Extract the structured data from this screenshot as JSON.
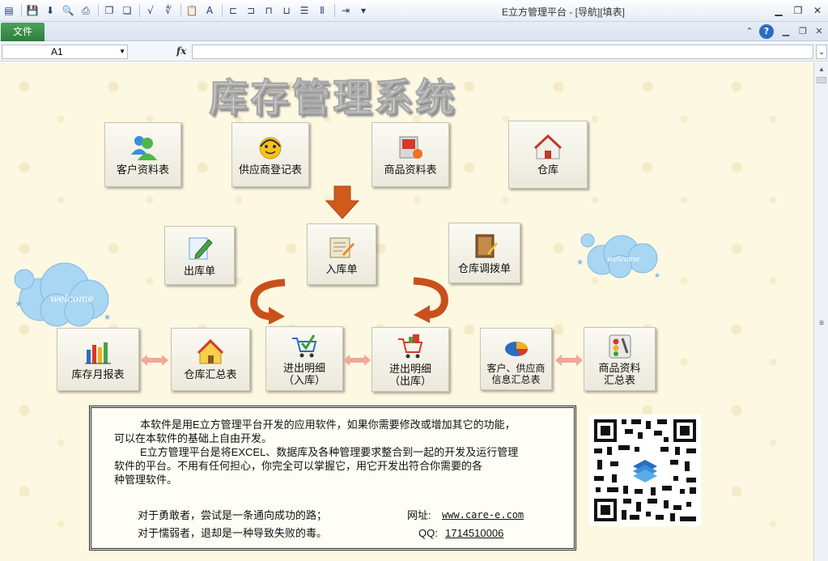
{
  "window": {
    "title": "E立方管理平台 - [导航][填表]"
  },
  "ribbon": {
    "file_tab": "文件"
  },
  "formula_bar": {
    "name_box": "A1",
    "fx_label": "fx",
    "formula": ""
  },
  "sheet": {
    "title": "库存管理系统",
    "buttons": {
      "customer": "客户资料表",
      "supplier": "供应商登记表",
      "product": "商品资料表",
      "warehouse": "仓库",
      "outbound": "出库单",
      "inbound": "入库单",
      "transfer": "仓库调拨单",
      "monthly": "库存月报表",
      "summary": "仓库汇总表",
      "detail_in": "进出明细\n（入库）",
      "detail_out": "进出明细\n（出库）",
      "party_summary": "客户、供应商\n信息汇总表",
      "product_summary": "商品资料\n汇总表"
    },
    "info": {
      "p1_line1": "本软件是用E立方管理平台开发的应用软件，如果你需要修改或增加其它的功能，",
      "p1_line2": "可以在本软件的基础上自由开发。",
      "p2_line1": "E立方管理平台是将EXCEL、数据库及各种管理要求整合到一起的开发及运行管理",
      "p2_line2": "软件的平台。不用有任何担心，你完全可以掌握它，用它开发出符合你需要的各",
      "p2_line3": "种管理软件。",
      "motto1": "对于勇敢者，尝试是一条通向成功的路；",
      "motto2": "对于懦弱者，退却是一种导致失败的毒。",
      "website_label": "网址:",
      "website": "www.care-e.com",
      "qq_label": "QQ:",
      "qq": "1714510006"
    },
    "cloud_text": "welcome"
  },
  "colors": {
    "file_tab": "#2e7d3c",
    "sheet_bg": "#fdf8e2",
    "flow_arrow": "#c9501c",
    "pink_arrow": "#f0a898",
    "cloud": "#a9d6f2"
  }
}
